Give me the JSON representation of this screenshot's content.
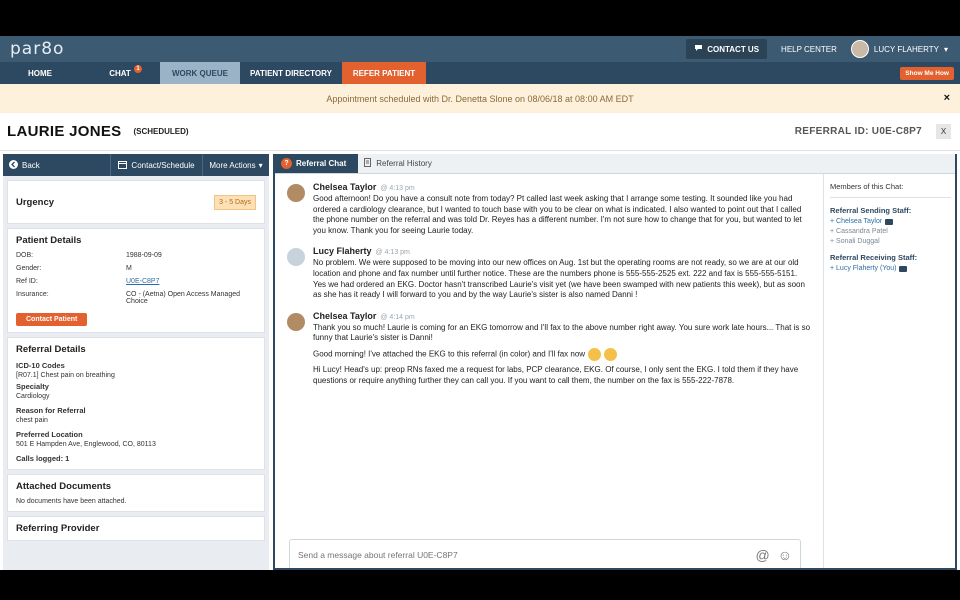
{
  "header": {
    "logo": "par8o",
    "contact_us": "CONTACT US",
    "help_center": "HELP CENTER",
    "user_name": "LUCY FLAHERTY"
  },
  "nav": {
    "items": [
      "HOME",
      "CHAT",
      "WORK QUEUE",
      "PATIENT DIRECTORY",
      "REFER PATIENT"
    ],
    "chat_badge": "1",
    "show_me_how": "Show Me How"
  },
  "notice": {
    "text": "Appointment scheduled with Dr. Denetta Slone on 08/06/18 at 08:00 AM EDT",
    "close": "×"
  },
  "patient": {
    "name": "LAURIE JONES",
    "status": "(SCHEDULED)",
    "referral_id": "REFERRAL ID: U0E-C8P7",
    "close": "X"
  },
  "left_toolbar": {
    "back": "Back",
    "contact_schedule": "Contact/Schedule",
    "more_actions": "More Actions"
  },
  "urgency": {
    "title": "Urgency",
    "value": "3 - 5 Days"
  },
  "patient_details": {
    "title": "Patient Details",
    "rows": [
      {
        "k": "DOB:",
        "v": "1988-09-09"
      },
      {
        "k": "Gender:",
        "v": "M"
      },
      {
        "k": "Ref ID:",
        "v": "U0E-C8P7"
      },
      {
        "k": "Insurance:",
        "v": "CO - (Aetna) Open Access Managed Choice"
      }
    ],
    "contact_button": "Contact Patient"
  },
  "referral_details": {
    "title": "Referral Details",
    "icd_label": "ICD-10 Codes",
    "icd_value": "[R07.1] Chest pain on breathing",
    "specialty_label": "Specialty",
    "specialty_value": "Cardiology",
    "reason_label": "Reason for Referral",
    "reason_value": "chest pain",
    "location_label": "Preferred Location",
    "location_value": "501 E Hampden Ave, Englewood, CO, 80113",
    "calls_label": "Calls logged: 1"
  },
  "attached": {
    "title": "Attached Documents",
    "text": "No documents have been attached."
  },
  "referring": {
    "title": "Referring Provider"
  },
  "chat": {
    "tab_active": "Referral Chat",
    "tab_inactive": "Referral History",
    "messages": [
      {
        "author": "Chelsea Taylor",
        "time": "@ 4:13 pm",
        "paragraphs": [
          "Good afternoon! Do you have a consult note from today? Pt called last week asking that I arrange some testing. It sounded like you had ordered a cardiology clearance, but I wanted to touch base with you to be clear on what is indicated. I also wanted to point out that I called the phone number on the referral and was told Dr. Reyes has a different number. I'm not sure how to change that for you, but wanted to let you know. Thank you for seeing Laurie today."
        ]
      },
      {
        "author": "Lucy Flaherty",
        "time": "@ 4:13 pm",
        "paragraphs": [
          "No problem. We were supposed to be moving into our new offices on Aug. 1st but the operating rooms are not ready, so we are at our old location and phone and fax number until further notice. These are the numbers phone is 555-555-2525 ext. 222 and fax is 555-555-5151. Yes we had ordered an EKG. Doctor hasn't transcribed Laurie's visit yet (we have been swamped with new patients this week), but as soon as she has it ready I will forward to you and by the way Laurie's sister is also named Danni !"
        ]
      },
      {
        "author": "Chelsea Taylor",
        "time": "@ 4:14 pm",
        "paragraphs": [
          "Thank you so much! Laurie is coming for an EKG tomorrow and I'll fax to the above number right away. You sure work late hours... That is so funny that Laurie's sister is Danni!",
          "Good morning! I've attached the EKG to this referral (in color) and I'll fax now",
          "Hi Lucy! Head's up: preop RNs faxed me a request for labs, PCP clearance, EKG. Of course, I only sent the EKG. I told them if they have questions or require anything further they can call you. If you want to call them, the number on the fax is 555-222-7878."
        ]
      }
    ],
    "composer_placeholder": "Send a message about referral U0E-C8P7"
  },
  "members": {
    "title": "Members of this Chat:",
    "sending_title": "Referral Sending Staff:",
    "sending": [
      "+ Chelsea Taylor",
      "+ Cassandra Patel",
      "+ Sonali Duggal"
    ],
    "receiving_title": "Referral Receiving Staff:",
    "receiving": [
      "+ Lucy Flaherty (You)"
    ]
  },
  "icons": {
    "chat_bubble": "chat-icon",
    "back_arrow": "back-arrow-icon",
    "calendar": "calendar-icon",
    "at": "@",
    "smiley": "☺"
  },
  "colors": {
    "navy": "#2d4861",
    "orange": "#e2612f",
    "notice_bg": "#fdf1dc"
  }
}
